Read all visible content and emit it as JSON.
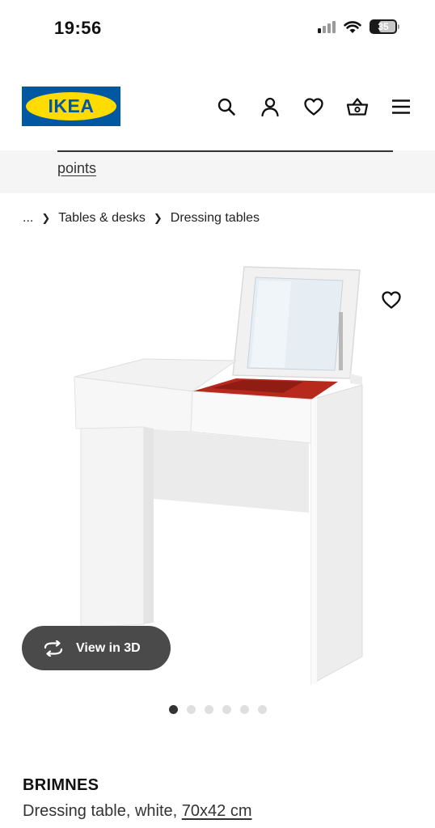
{
  "status_bar": {
    "time": "19:56",
    "battery_level": "35",
    "icons": [
      "signal-icon",
      "wifi-icon",
      "battery-icon"
    ]
  },
  "header": {
    "logo_text": "IKEA",
    "icons": [
      "search-icon",
      "account-icon",
      "favorites-icon",
      "basket-icon",
      "menu-icon"
    ]
  },
  "promo": {
    "link_text": "points"
  },
  "breadcrumb": {
    "ellipsis": "...",
    "items": [
      "Tables & desks",
      "Dressing tables"
    ]
  },
  "gallery": {
    "view_3d_label": "View in 3D",
    "image_count": 6,
    "active_index": 0
  },
  "product": {
    "name": "BRIMNES",
    "description": "Dressing table, white, ",
    "dimensions": "70x42 cm"
  },
  "colors": {
    "ikea_blue": "#0058a3",
    "ikea_yellow": "#ffdb00",
    "promo_bg": "#f5f5f5",
    "view3d_bg": "#4a4a4a",
    "drawer_red": "#b7281d"
  }
}
